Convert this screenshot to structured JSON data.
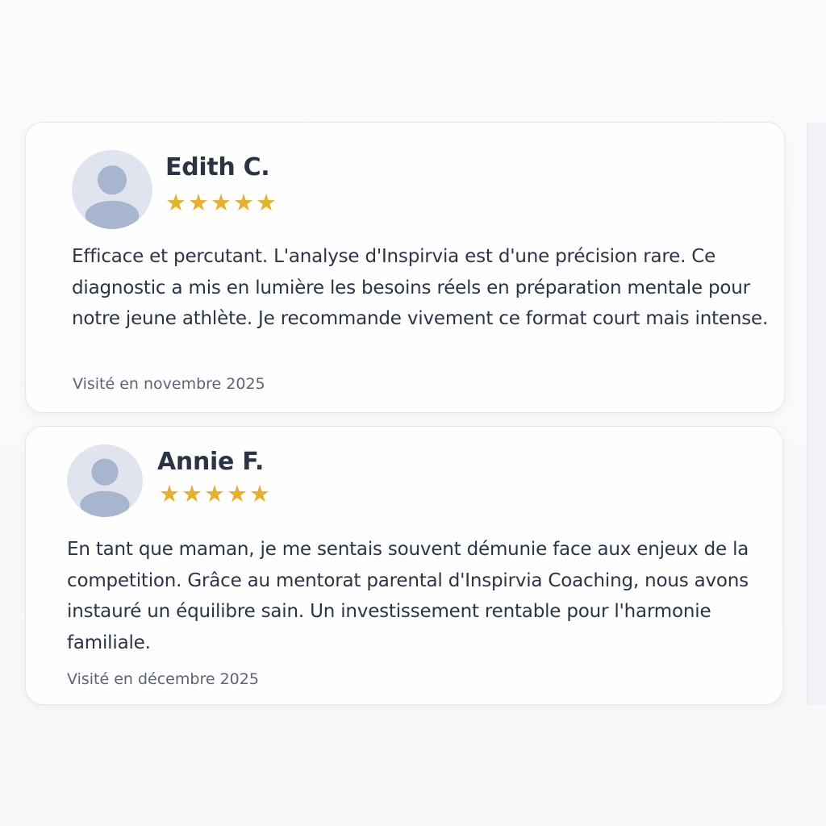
{
  "colors": {
    "star": "#e3b12f",
    "name_text": "#2b3444",
    "body_text": "#2b3444",
    "date_text": "#5d6475",
    "avatar_bg": "#dfe4ef",
    "avatar_figure": "#a7b5cf"
  },
  "reviews": [
    {
      "name": "Edith C.",
      "rating": 5,
      "star_glyph": "★",
      "text": "Efficace et percutant. L'analyse d'Inspirvia est d'une précision rare. Ce diagnostic a mis en lumière les besoins réels en préparation mentale pour notre jeune athlète. Je recommande vivement ce format court mais intense.",
      "visit": "Visité en novembre 2025",
      "avatar_icon": "user-placeholder-icon"
    },
    {
      "name": "Annie F.",
      "rating": 5,
      "star_glyph": "★",
      "text": "En tant que maman, je me sentais souvent démunie face aux enjeux de la competition. Grâce au mentorat parental d'Inspirvia Coaching, nous avons instauré un équilibre sain. Un investissement rentable pour l'harmonie familiale.",
      "visit": "Visité en décembre 2025",
      "avatar_icon": "user-placeholder-icon"
    }
  ]
}
